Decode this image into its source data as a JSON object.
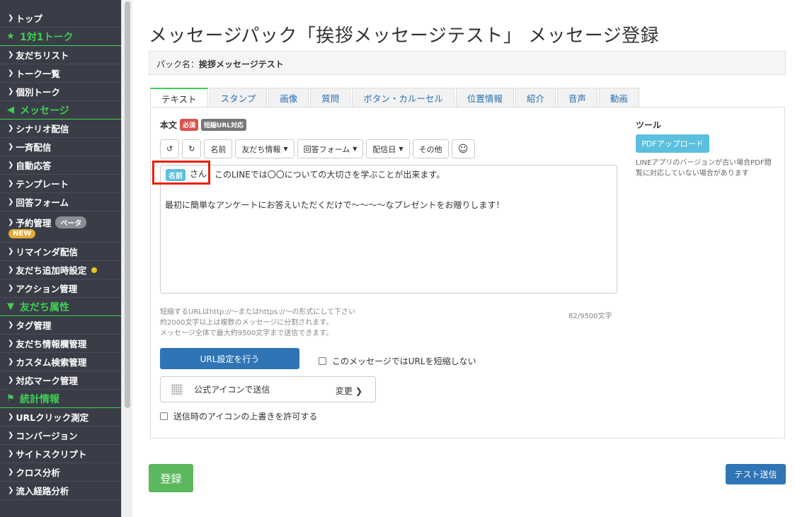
{
  "sidebar": {
    "top": "トップ",
    "sec1": "1対1トーク",
    "friend_list": "友だちリスト",
    "talk_list": "トーク一覧",
    "individual_talk": "個別トーク",
    "sec2": "メッセージ",
    "scenario": "シナリオ配信",
    "broadcast": "一斉配信",
    "auto_reply": "自動応答",
    "template": "テンプレート",
    "answer_form": "回答フォーム",
    "reservation": "予約管理",
    "beta": "ベータ",
    "new": "NEW",
    "reminder": "リマインダ配信",
    "friend_add": "友だち追加時設定",
    "action": "アクション管理",
    "sec3": "友だち属性",
    "tag": "タグ管理",
    "friend_info": "友だち情報欄管理",
    "custom_search": "カスタム検索管理",
    "mark": "対応マーク管理",
    "sec4": "統計情報",
    "url_click": "URLクリック測定",
    "conversion": "コンバージョン",
    "site_script": "サイトスクリプト",
    "cross": "クロス分析",
    "inflow": "流入経路分析"
  },
  "page": {
    "title": "メッセージパック「挨拶メッセージテスト」 メッセージ登録",
    "pack_label": "パック名：",
    "pack_name": "挨拶メッセージテスト"
  },
  "tabs": [
    "テキスト",
    "スタンプ",
    "画像",
    "質問",
    "ボタン・カルーセル",
    "位置情報",
    "紹介",
    "音声",
    "動画"
  ],
  "editor": {
    "body_label": "本文",
    "required": "必須",
    "short_url": "短縮URL対応",
    "toolbar": {
      "undo": "↺",
      "redo": "↻",
      "name": "名前",
      "friend_info": "友だち情報",
      "answer_form": "回答フォーム",
      "delivery_date": "配信日",
      "other": "その他",
      "emoji": "☺"
    },
    "name_tag": "名前",
    "san": "さん",
    "line1": "このLINEでは〇〇についての大切さを学ぶことが出来ます。",
    "line2": "最初に簡単なアンケートにお答えいただくだけで〜〜〜〜なプレゼントをお贈りします！",
    "help1": "短縮するURLはhttp://〜またはhttps://〜の形式にして下さい",
    "help2": "約2000文字以上は複数のメッセージに分割されます。",
    "help3": "メッセージ全体で最大約9500文字まで送信できます。",
    "count": "82/9500文字",
    "url_button": "URL設定を行う",
    "no_shorten": "このメッセージではURLを短縮しない",
    "official_icon": "公式アイコンで送信",
    "change": "変更",
    "allow_overwrite": "送信時のアイコンの上書きを許可する"
  },
  "tools": {
    "title": "ツール",
    "pdf": "PDFアップロード",
    "note": "LINEアプリのバージョンが古い場合PDF閲覧に対応していない場合があります"
  },
  "actions": {
    "register": "登録",
    "test_send": "テスト送信"
  },
  "colors": {
    "accent_green": "#3ecf52",
    "primary_blue": "#2f74b5",
    "highlight_red": "#e8200a"
  }
}
